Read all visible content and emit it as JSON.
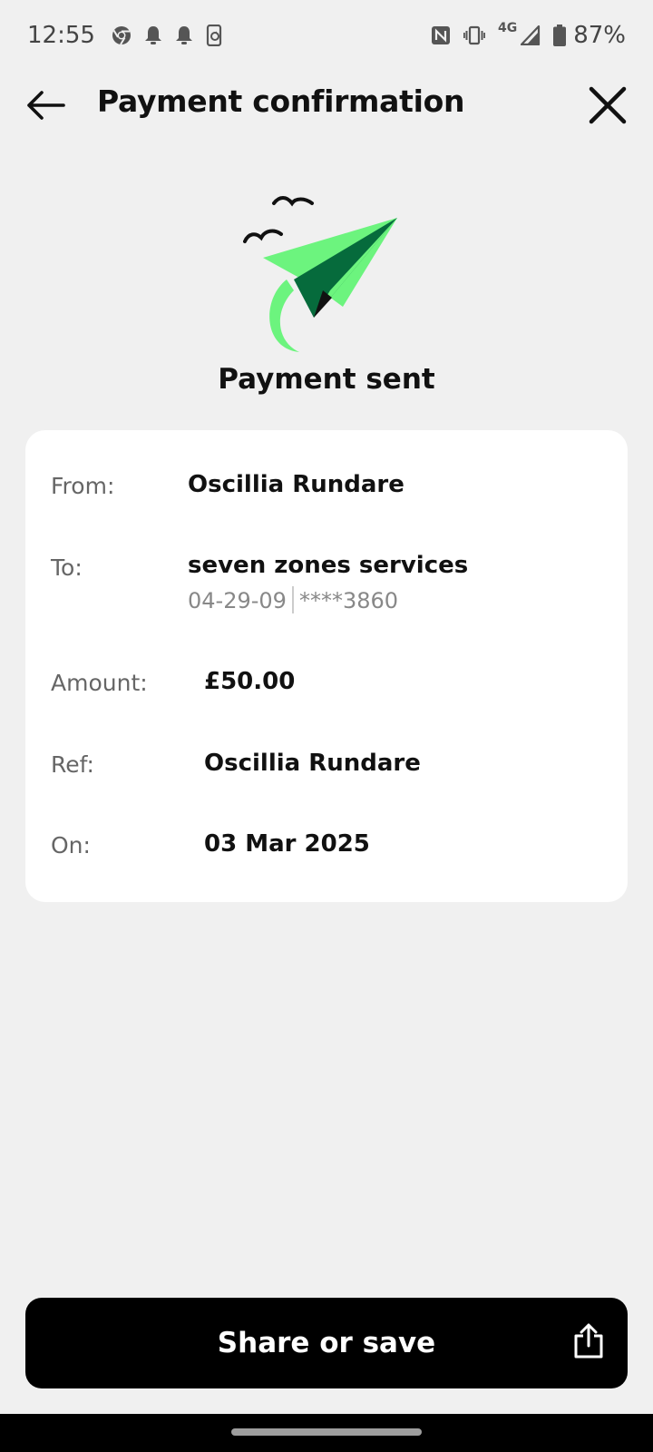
{
  "status_bar": {
    "time": "12:55",
    "network": "4G",
    "battery": "87%",
    "icons": [
      "chrome-icon",
      "notification-bell-icon",
      "notification-bell-icon",
      "phone-sync-icon",
      "nfc-icon",
      "vibrate-icon",
      "signal-icon",
      "battery-icon"
    ]
  },
  "header": {
    "title": "Payment confirmation",
    "back_icon": "arrow-left-icon",
    "close_icon": "close-icon"
  },
  "confirmation": {
    "title": "Payment sent",
    "illustration": "paper-plane-birds-illustration"
  },
  "details": {
    "from_label": "From:",
    "from_value": "Oscillia Rundare",
    "to_label": "To:",
    "to_value": "seven zones services",
    "to_sort_code": "04-29-09",
    "to_account": "****3860",
    "amount_label": "Amount:",
    "amount_value": "£50.00",
    "ref_label": "Ref:",
    "ref_value": "Oscillia Rundare",
    "on_label": "On:",
    "on_value": "03 Mar 2025"
  },
  "actions": {
    "share_label": "Share or save",
    "share_icon": "share-upload-icon"
  },
  "colors": {
    "background": "#f0f0f0",
    "card": "#ffffff",
    "accent_green": "#6cf47e",
    "dark_green": "#066b3c",
    "button": "#000000"
  }
}
